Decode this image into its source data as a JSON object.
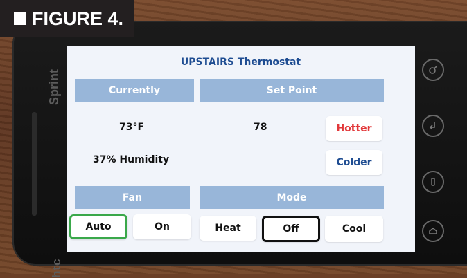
{
  "figure_label": "FIGURE 4.",
  "device": {
    "carrier": "Sprint",
    "brand": "htc"
  },
  "screen": {
    "title": "UPSTAIRS Thermostat",
    "headers": {
      "currently": "Currently",
      "set_point": "Set Point",
      "fan": "Fan",
      "mode": "Mode"
    },
    "current_temperature": "73°F",
    "humidity": "37% Humidity",
    "set_point_value": "78",
    "buttons": {
      "hotter": "Hotter",
      "colder": "Colder",
      "fan_auto": "Auto",
      "fan_on": "On",
      "mode_heat": "Heat",
      "mode_off": "Off",
      "mode_cool": "Cool"
    },
    "selected": {
      "fan": "Auto",
      "mode": "Off"
    }
  },
  "hardware_icons": [
    "search-icon",
    "back-icon",
    "menu-icon",
    "home-icon"
  ],
  "colors": {
    "title": "#1f4d92",
    "header": "#98b6d9",
    "hotter": "#e2383a",
    "colder": "#1f4d92",
    "fan_selected_border": "#3aa84a",
    "mode_selected_border": "#111111"
  }
}
